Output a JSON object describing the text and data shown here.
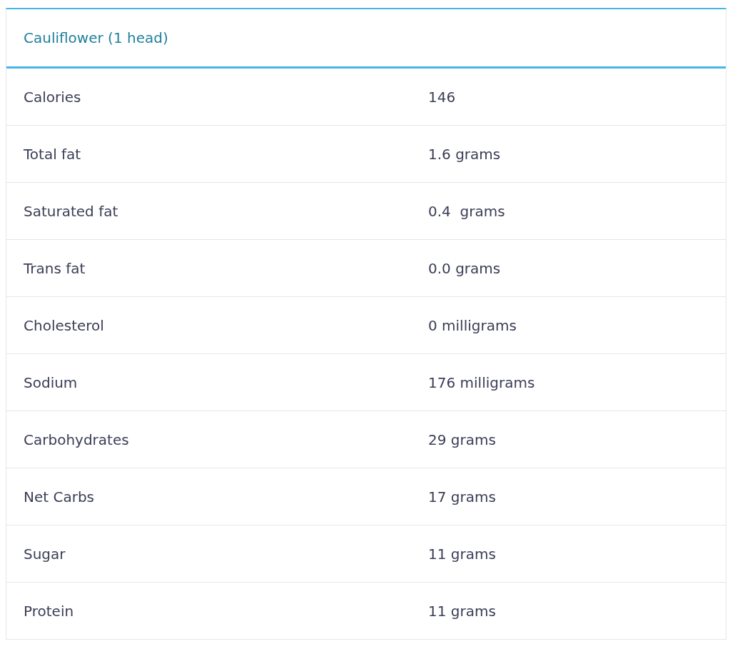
{
  "table": {
    "title": "Cauliflower (1 head)",
    "rows": [
      {
        "nutrient": "Calories",
        "amount": "146"
      },
      {
        "nutrient": "Total fat",
        "amount": "1.6 grams"
      },
      {
        "nutrient": "Saturated fat",
        "amount": "0.4  grams"
      },
      {
        "nutrient": "Trans fat",
        "amount": "0.0 grams"
      },
      {
        "nutrient": "Cholesterol",
        "amount": "0 milligrams"
      },
      {
        "nutrient": "Sodium",
        "amount": "176 milligrams"
      },
      {
        "nutrient": "Carbohydrates",
        "amount": "29 grams"
      },
      {
        "nutrient": "Net Carbs",
        "amount": "17 grams"
      },
      {
        "nutrient": "Sugar",
        "amount": "11 grams"
      },
      {
        "nutrient": "Protein",
        "amount": "11 grams"
      }
    ]
  }
}
